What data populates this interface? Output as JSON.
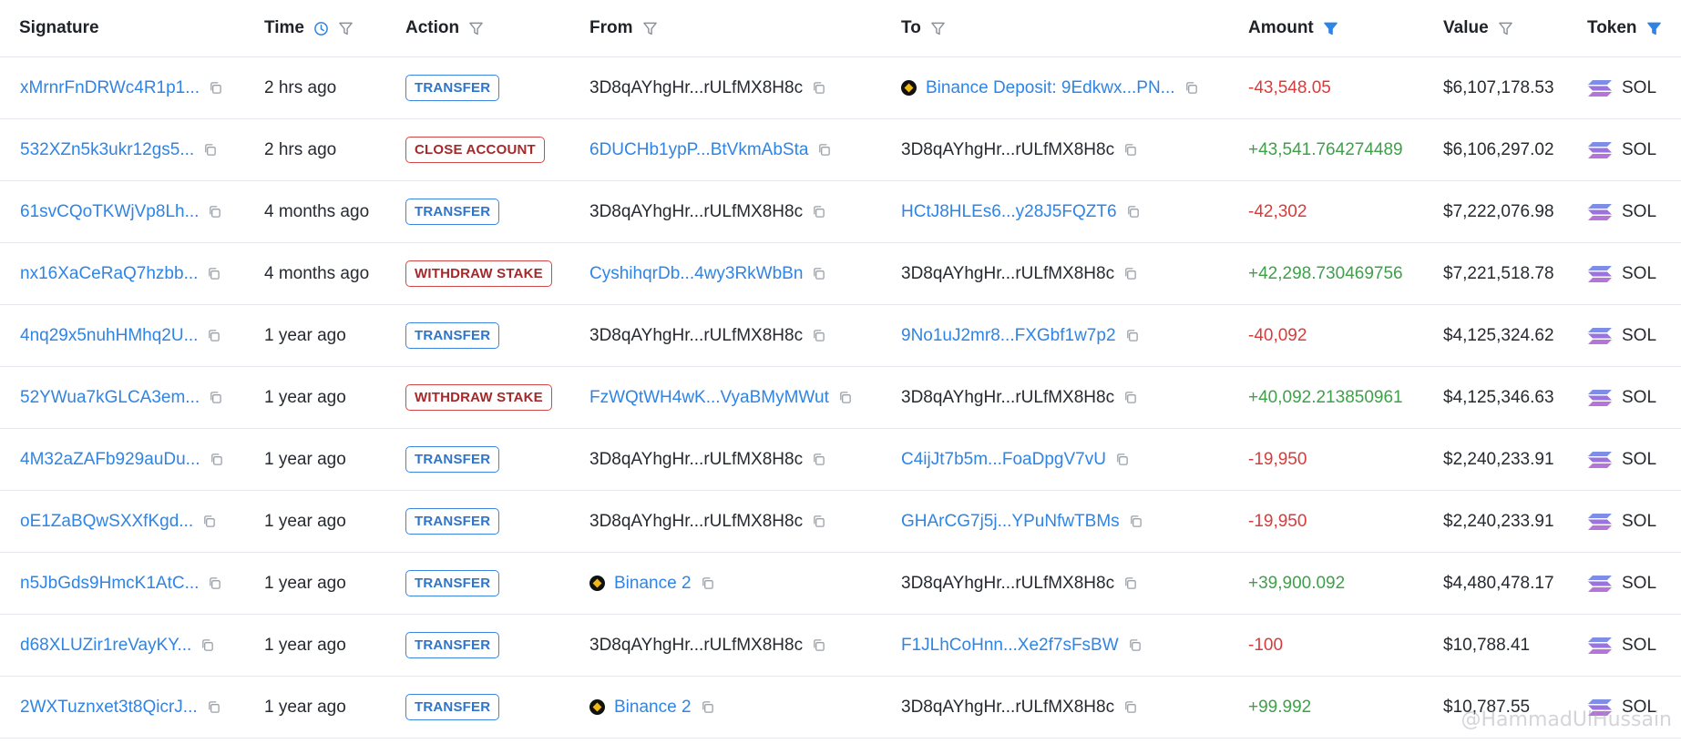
{
  "headers": {
    "signature": "Signature",
    "time": "Time",
    "action": "Action",
    "from": "From",
    "to": "To",
    "amount": "Amount",
    "value": "Value",
    "token": "Token"
  },
  "colors": {
    "link": "#2f84e4",
    "negative": "#d93b3b",
    "positive": "#3fa04a",
    "filter_active": "#2f84e4",
    "badge_transfer": "#3a86e0",
    "badge_red": "#d04848"
  },
  "rows": [
    {
      "signature": "xMrnrFnDRWc4R1p1...",
      "time": "2 hrs ago",
      "action": "TRANSFER",
      "action_style": "blue",
      "from": "3D8qAYhgHr...rULfMX8H8c",
      "from_link": false,
      "from_binance": false,
      "to": "Binance Deposit: 9Edkwx...PN...",
      "to_link": true,
      "to_binance": true,
      "amount": "-43,548.05",
      "amount_sign": "neg",
      "value": "$6,107,178.53",
      "token": "SOL"
    },
    {
      "signature": "532XZn5k3ukr12gs5...",
      "time": "2 hrs ago",
      "action": "CLOSE ACCOUNT",
      "action_style": "red",
      "from": "6DUCHb1ypP...BtVkmAbSta",
      "from_link": true,
      "from_binance": false,
      "to": "3D8qAYhgHr...rULfMX8H8c",
      "to_link": false,
      "to_binance": false,
      "amount": "+43,541.764274489",
      "amount_sign": "pos",
      "value": "$6,106,297.02",
      "token": "SOL"
    },
    {
      "signature": "61svCQoTKWjVp8Lh...",
      "time": "4 months ago",
      "action": "TRANSFER",
      "action_style": "blue",
      "from": "3D8qAYhgHr...rULfMX8H8c",
      "from_link": false,
      "from_binance": false,
      "to": "HCtJ8HLEs6...y28J5FQZT6",
      "to_link": true,
      "to_binance": false,
      "amount": "-42,302",
      "amount_sign": "neg",
      "value": "$7,222,076.98",
      "token": "SOL"
    },
    {
      "signature": "nx16XaCeRaQ7hzbb...",
      "time": "4 months ago",
      "action": "WITHDRAW STAKE",
      "action_style": "red",
      "from": "CyshihqrDb...4wy3RkWbBn",
      "from_link": true,
      "from_binance": false,
      "to": "3D8qAYhgHr...rULfMX8H8c",
      "to_link": false,
      "to_binance": false,
      "amount": "+42,298.730469756",
      "amount_sign": "pos",
      "value": "$7,221,518.78",
      "token": "SOL"
    },
    {
      "signature": "4nq29x5nuhHMhq2U...",
      "time": "1 year ago",
      "action": "TRANSFER",
      "action_style": "blue",
      "from": "3D8qAYhgHr...rULfMX8H8c",
      "from_link": false,
      "from_binance": false,
      "to": "9No1uJ2mr8...FXGbf1w7p2",
      "to_link": true,
      "to_binance": false,
      "amount": "-40,092",
      "amount_sign": "neg",
      "value": "$4,125,324.62",
      "token": "SOL"
    },
    {
      "signature": "52YWua7kGLCA3em...",
      "time": "1 year ago",
      "action": "WITHDRAW STAKE",
      "action_style": "red",
      "from": "FzWQtWH4wK...VyaBMyMWut",
      "from_link": true,
      "from_binance": false,
      "to": "3D8qAYhgHr...rULfMX8H8c",
      "to_link": false,
      "to_binance": false,
      "amount": "+40,092.213850961",
      "amount_sign": "pos",
      "value": "$4,125,346.63",
      "token": "SOL"
    },
    {
      "signature": "4M32aZAFb929auDu...",
      "time": "1 year ago",
      "action": "TRANSFER",
      "action_style": "blue",
      "from": "3D8qAYhgHr...rULfMX8H8c",
      "from_link": false,
      "from_binance": false,
      "to": "C4ijJt7b5m...FoaDpgV7vU",
      "to_link": true,
      "to_binance": false,
      "amount": "-19,950",
      "amount_sign": "neg",
      "value": "$2,240,233.91",
      "token": "SOL"
    },
    {
      "signature": "oE1ZaBQwSXXfKgd...",
      "time": "1 year ago",
      "action": "TRANSFER",
      "action_style": "blue",
      "from": "3D8qAYhgHr...rULfMX8H8c",
      "from_link": false,
      "from_binance": false,
      "to": "GHArCG7j5j...YPuNfwTBMs",
      "to_link": true,
      "to_binance": false,
      "amount": "-19,950",
      "amount_sign": "neg",
      "value": "$2,240,233.91",
      "token": "SOL"
    },
    {
      "signature": "n5JbGds9HmcK1AtC...",
      "time": "1 year ago",
      "action": "TRANSFER",
      "action_style": "blue",
      "from": "Binance 2",
      "from_link": true,
      "from_binance": true,
      "to": "3D8qAYhgHr...rULfMX8H8c",
      "to_link": false,
      "to_binance": false,
      "amount": "+39,900.092",
      "amount_sign": "pos",
      "value": "$4,480,478.17",
      "token": "SOL"
    },
    {
      "signature": "d68XLUZir1reVayKY...",
      "time": "1 year ago",
      "action": "TRANSFER",
      "action_style": "blue",
      "from": "3D8qAYhgHr...rULfMX8H8c",
      "from_link": false,
      "from_binance": false,
      "to": "F1JLhCoHnn...Xe2f7sFsBW",
      "to_link": true,
      "to_binance": false,
      "amount": "-100",
      "amount_sign": "neg",
      "value": "$10,788.41",
      "token": "SOL"
    },
    {
      "signature": "2WXTuznxet3t8QicrJ...",
      "time": "1 year ago",
      "action": "TRANSFER",
      "action_style": "blue",
      "from": "Binance 2",
      "from_link": true,
      "from_binance": true,
      "to": "3D8qAYhgHr...rULfMX8H8c",
      "to_link": false,
      "to_binance": false,
      "amount": "+99.992",
      "amount_sign": "pos",
      "value": "$10,787.55",
      "token": "SOL"
    }
  ],
  "watermark": "@HammadUlHussain"
}
